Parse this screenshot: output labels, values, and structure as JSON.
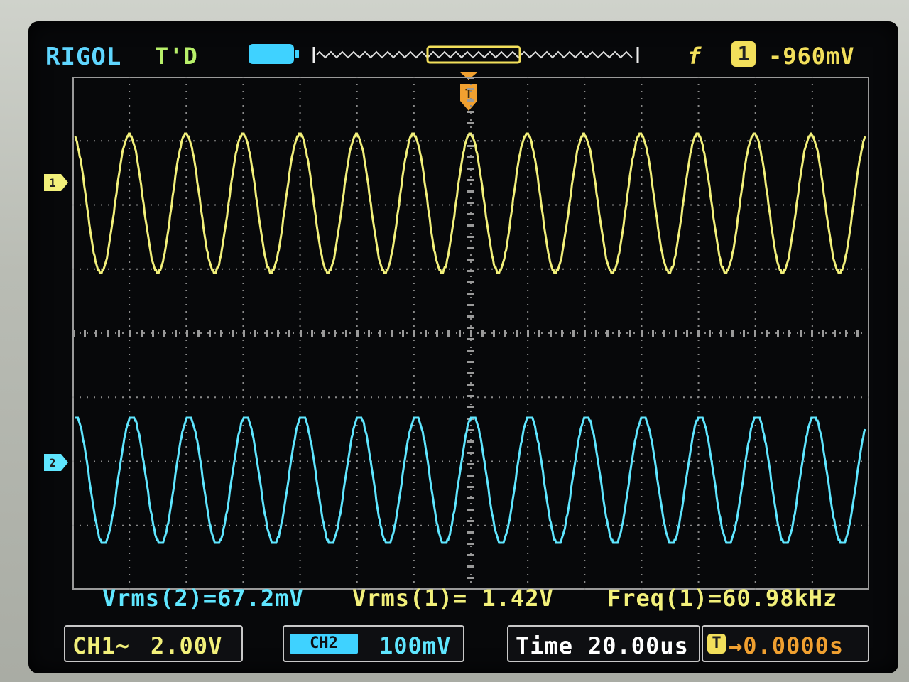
{
  "header": {
    "brand": "RIGOL",
    "trigger_status": "T'D",
    "trigger_edge_symbol": "f",
    "trigger_source": "1",
    "trigger_level": "-960mV"
  },
  "measurements": {
    "m1": "Vrms(2)=67.2mV",
    "m2": "Vrms(1)= 1.42V",
    "m3": "Freq(1)=60.98kHz"
  },
  "bottom": {
    "ch1_label": "CH1~",
    "ch1_scale": "2.00V",
    "ch2_tag": "CH2",
    "ch2_scale": "100mV",
    "time_label": "Time",
    "time_scale": "20.00us",
    "trigger_pos_label": "→0.0000s"
  },
  "markers": {
    "ch1": "1",
    "ch2": "2",
    "trigger": "T"
  },
  "colors": {
    "ch1": "#f2f07a",
    "ch2": "#5fe6ff",
    "brand": "#5fd6ff",
    "status": "#b8f06a",
    "grid": "#8a8a8a",
    "orange": "#f0a030"
  },
  "chart_data": {
    "type": "line",
    "xlim_divisions": 14,
    "ylim_divisions": 8,
    "series": [
      {
        "name": "CH1",
        "cycles": 13.9,
        "phase_offset": 0.05
      },
      {
        "name": "CH2",
        "cycles": 13.9,
        "phase_offset": 0.0
      }
    ]
  }
}
